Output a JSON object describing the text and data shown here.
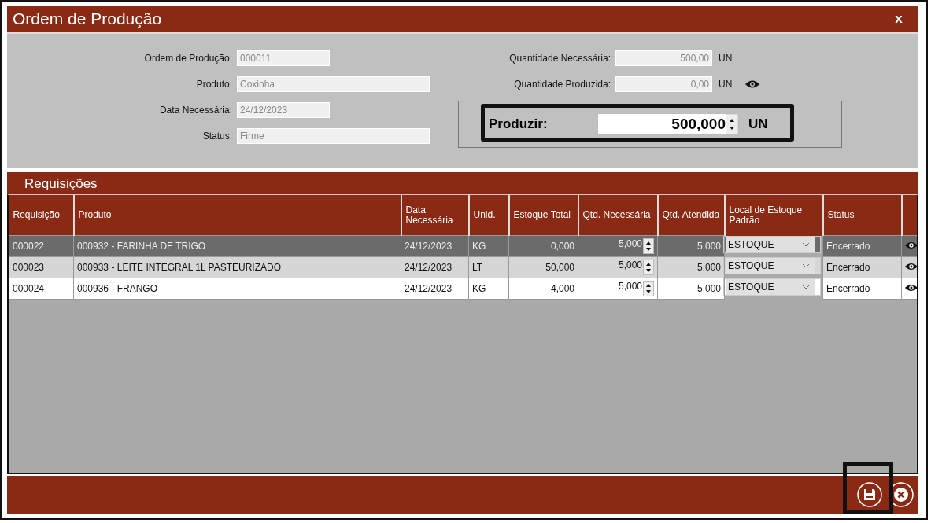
{
  "window": {
    "title": "Ordem de Produção",
    "minimize": "_",
    "close": "x"
  },
  "form_left": [
    {
      "label": "Ordem de Produção:",
      "value": "000011",
      "wide": false
    },
    {
      "label": "Produto:",
      "value": "Coxinha",
      "wide": true
    },
    {
      "label": "Data Necessária:",
      "value": "24/12/2023",
      "wide": false
    },
    {
      "label": "Status:",
      "value": "Firme",
      "wide": true
    }
  ],
  "form_right": [
    {
      "label": "Quantidade Necessária:",
      "value": "500,00",
      "unit": "UN",
      "has_view": false
    },
    {
      "label": "Quantidade Produzida:",
      "value": "0,00",
      "unit": "UN",
      "has_view": true
    }
  ],
  "produce": {
    "label": "Produzir:",
    "value": "500,000",
    "unit": "UN"
  },
  "requisitions": {
    "title": "Requisições",
    "columns": [
      "Requisição",
      "Produto",
      "Data Necessária",
      "Unid.",
      "Estoque Total",
      "Qtd. Necessária",
      "Qtd. Atendida",
      "Local de Estoque Padrão",
      "Status"
    ],
    "rows": [
      {
        "selected": true,
        "cells": [
          "000022",
          "000932 - FARINHA DE TRIGO",
          "24/12/2023",
          "KG",
          "0,000",
          "5,000",
          "5,000",
          "ESTOQUE",
          "Encerrado"
        ]
      },
      {
        "selected": false,
        "cells": [
          "000023",
          "000933 - LEITE INTEGRAL 1L PASTEURIZADO",
          "24/12/2023",
          "LT",
          "50,000",
          "5,000",
          "5,000",
          "ESTOQUE",
          "Encerrado"
        ]
      },
      {
        "selected": false,
        "cells": [
          "000024",
          "000936 - FRANGO",
          "24/12/2023",
          "KG",
          "4,000",
          "5,000",
          "5,000",
          "ESTOQUE",
          "Encerrado"
        ]
      }
    ]
  }
}
